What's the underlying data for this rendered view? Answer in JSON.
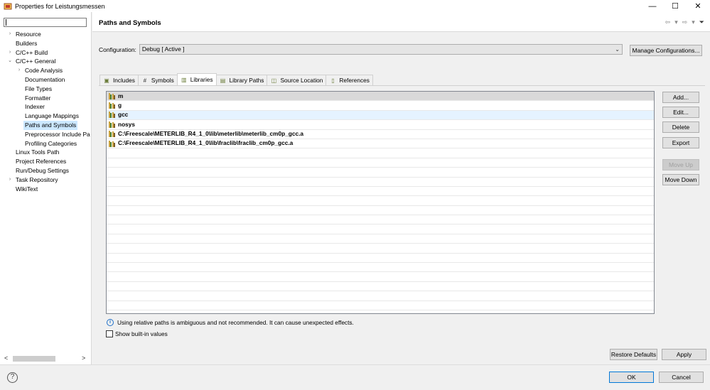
{
  "window": {
    "title": "Properties for Leistungsmessen",
    "controls": {
      "minimize": "—",
      "maximize": "☐",
      "close": "✕"
    }
  },
  "tree": {
    "filter_value": "",
    "items": [
      {
        "label": "Resource",
        "expander": "›",
        "level": 0
      },
      {
        "label": "Builders",
        "expander": "",
        "level": 0
      },
      {
        "label": "C/C++ Build",
        "expander": "›",
        "level": 0
      },
      {
        "label": "C/C++ General",
        "expander": "⌄",
        "level": 0
      },
      {
        "label": "Code Analysis",
        "expander": "›",
        "level": 1
      },
      {
        "label": "Documentation",
        "expander": "",
        "level": 1
      },
      {
        "label": "File Types",
        "expander": "",
        "level": 1
      },
      {
        "label": "Formatter",
        "expander": "",
        "level": 1
      },
      {
        "label": "Indexer",
        "expander": "",
        "level": 1
      },
      {
        "label": "Language Mappings",
        "expander": "",
        "level": 1
      },
      {
        "label": "Paths and Symbols",
        "expander": "",
        "level": 1,
        "selected": true
      },
      {
        "label": "Preprocessor Include Pa",
        "expander": "",
        "level": 1
      },
      {
        "label": "Profiling Categories",
        "expander": "",
        "level": 1
      },
      {
        "label": "Linux Tools Path",
        "expander": "",
        "level": 0
      },
      {
        "label": "Project References",
        "expander": "",
        "level": 0
      },
      {
        "label": "Run/Debug Settings",
        "expander": "",
        "level": 0
      },
      {
        "label": "Task Repository",
        "expander": "›",
        "level": 0
      },
      {
        "label": "WikiText",
        "expander": "",
        "level": 0
      }
    ],
    "scroll_left": "<",
    "scroll_right": ">"
  },
  "page": {
    "title": "Paths and Symbols",
    "nav": {
      "back": "⇦",
      "back_menu": "▾",
      "forward": "⇨",
      "forward_menu": "▾",
      "view_menu": "⏷"
    }
  },
  "config": {
    "label": "Configuration:",
    "value": "Debug  [ Active ]",
    "manage_label": "Manage Configurations..."
  },
  "tabs": [
    {
      "label": "Includes",
      "icon": "includes-icon",
      "glyph": "▣",
      "active": false
    },
    {
      "label": "Symbols",
      "icon": "hash-icon",
      "glyph": "#",
      "active": false
    },
    {
      "label": "Libraries",
      "icon": "library-icon",
      "glyph": "▥",
      "active": true
    },
    {
      "label": "Library Paths",
      "icon": "library-path-icon",
      "glyph": "▤",
      "active": false
    },
    {
      "label": "Source Location",
      "icon": "source-folder-icon",
      "glyph": "◫",
      "active": false
    },
    {
      "label": "References",
      "icon": "references-icon",
      "glyph": "▯",
      "active": false
    }
  ],
  "libraries": [
    {
      "name": "m",
      "state": "selected"
    },
    {
      "name": "g",
      "state": ""
    },
    {
      "name": "gcc",
      "state": "hover"
    },
    {
      "name": "nosys",
      "state": ""
    },
    {
      "name": "C:\\Freescale\\METERLIB_R4_1_0\\lib\\meterlib\\meterlib_cm0p_gcc.a",
      "state": ""
    },
    {
      "name": "C:\\Freescale\\METERLIB_R4_1_0\\lib\\fraclib\\fraclib_cm0p_gcc.a",
      "state": ""
    }
  ],
  "side_buttons": {
    "add": "Add...",
    "edit": "Edit...",
    "delete": "Delete",
    "export": "Export",
    "move_up": "Move Up",
    "move_down": "Move Down"
  },
  "info_text": "Using relative paths is ambiguous and not recommended. It can cause unexpected effects.",
  "info_glyph": "i",
  "show_builtin_label": "Show built-in values",
  "restore_defaults": "Restore Defaults",
  "apply": "Apply",
  "ok": "OK",
  "cancel": "Cancel",
  "help_glyph": "?"
}
